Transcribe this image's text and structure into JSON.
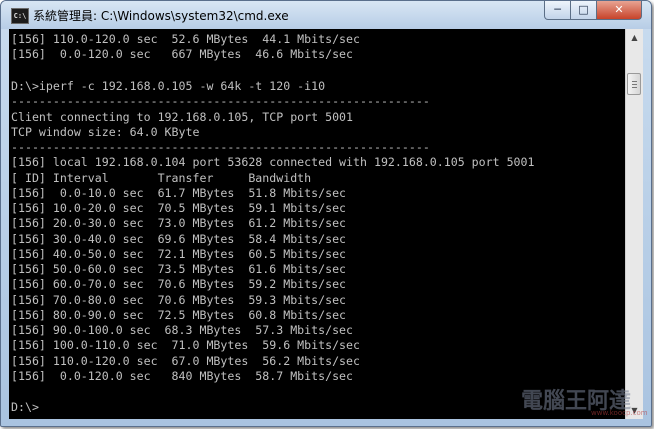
{
  "window": {
    "title": "系統管理員: C:\\Windows\\system32\\cmd.exe",
    "icon_label": "C:\\",
    "buttons": {
      "minimize": "─",
      "maximize": "□",
      "close": "✕"
    }
  },
  "console": {
    "lines": [
      "[156] 110.0-120.0 sec  52.6 MBytes  44.1 Mbits/sec",
      "[156]  0.0-120.0 sec   667 MBytes  46.6 Mbits/sec",
      "",
      "D:\\>iperf -c 192.168.0.105 -w 64k -t 120 -i10",
      "------------------------------------------------------------",
      "Client connecting to 192.168.0.105, TCP port 5001",
      "TCP window size: 64.0 KByte",
      "------------------------------------------------------------",
      "[156] local 192.168.0.104 port 53628 connected with 192.168.0.105 port 5001",
      "[ ID] Interval       Transfer     Bandwidth",
      "[156]  0.0-10.0 sec  61.7 MBytes  51.8 Mbits/sec",
      "[156] 10.0-20.0 sec  70.5 MBytes  59.1 Mbits/sec",
      "[156] 20.0-30.0 sec  73.0 MBytes  61.2 Mbits/sec",
      "[156] 30.0-40.0 sec  69.6 MBytes  58.4 Mbits/sec",
      "[156] 40.0-50.0 sec  72.1 MBytes  60.5 Mbits/sec",
      "[156] 50.0-60.0 sec  73.5 MBytes  61.6 Mbits/sec",
      "[156] 60.0-70.0 sec  70.6 MBytes  59.2 Mbits/sec",
      "[156] 70.0-80.0 sec  70.6 MBytes  59.3 Mbits/sec",
      "[156] 80.0-90.0 sec  72.5 MBytes  60.8 Mbits/sec",
      "[156] 90.0-100.0 sec  68.3 MBytes  57.3 Mbits/sec",
      "[156] 100.0-110.0 sec  71.0 MBytes  59.6 Mbits/sec",
      "[156] 110.0-120.0 sec  67.0 MBytes  56.2 Mbits/sec",
      "[156]  0.0-120.0 sec   840 MBytes  58.7 Mbits/sec",
      "",
      "D:\\>"
    ]
  },
  "scrollbar": {
    "up_arrow": "▲",
    "down_arrow": "▼"
  },
  "watermark": {
    "text": "電腦王阿達",
    "url": "www.koocp.com"
  },
  "colors": {
    "console_background": "#000000",
    "console_text": "#c0c0c0",
    "titlebar": "#c9dcef",
    "close_button": "#c7432a"
  }
}
